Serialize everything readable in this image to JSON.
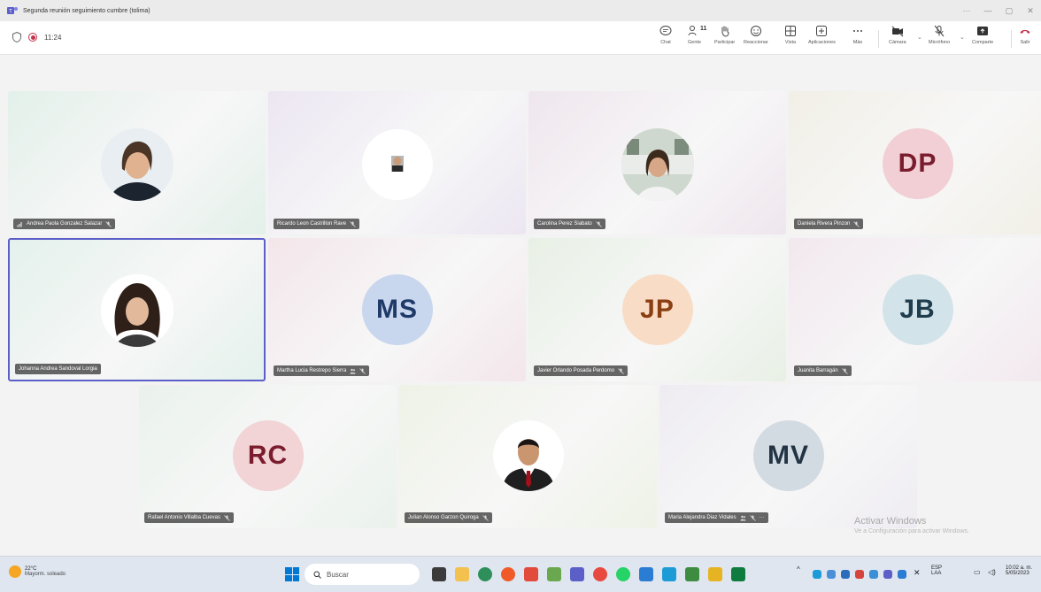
{
  "window": {
    "title": "Segunda reunión seguimiento cumbre (tolima)",
    "controls": [
      "···",
      "—",
      "▢",
      "✕"
    ]
  },
  "meeting": {
    "timer": "11:24",
    "people_count": "11",
    "tools": [
      {
        "label": "Chat",
        "icon": "chat-icon"
      },
      {
        "label": "Gente",
        "icon": "people-icon"
      },
      {
        "label": "Participar",
        "icon": "raise-hand-icon"
      },
      {
        "label": "Reaccionar",
        "icon": "react-icon"
      },
      {
        "label": "Vista",
        "icon": "view-icon"
      },
      {
        "label": "Aplicaciones",
        "icon": "apps-icon"
      },
      {
        "label": "Más",
        "icon": "more-icon"
      },
      {
        "label": "Cámara",
        "icon": "camera-icon"
      },
      {
        "label": "Micrófono",
        "icon": "mic-icon"
      },
      {
        "label": "Comparte",
        "icon": "share-icon"
      },
      {
        "label": "Salir",
        "icon": "leave-icon"
      }
    ]
  },
  "participants": [
    {
      "name": "Andrea Paola Gonzalez Salazar",
      "type": "photo",
      "bg": "#e3f0ea"
    },
    {
      "name": "Ricardo Leon Castrillon Rave",
      "type": "photo",
      "bg": "#ece6f2"
    },
    {
      "name": "Carolina Perez Siabato",
      "type": "photo",
      "bg": "#efe6ee"
    },
    {
      "name": "Daniela Rivera Pinzon",
      "initials": "DP",
      "type": "initials",
      "bg": "#f1efe6",
      "avatar_bg": "#f2cfd4",
      "avatar_fg": "#7a1c2e"
    },
    {
      "name": "Johanna Andrea Sandoval Lorgia",
      "type": "photo",
      "bg": "#e4f1ec"
    },
    {
      "name": "Martha Lucia Restrepo Sierra",
      "initials": "MS",
      "type": "initials",
      "bg": "#f3e6ea",
      "avatar_bg": "#c8d6ee",
      "avatar_fg": "#1f3a68"
    },
    {
      "name": "Javier Orlando Posada Perdomo",
      "initials": "JP",
      "type": "initials",
      "bg": "#e8f0e5",
      "avatar_bg": "#f9dcc6",
      "avatar_fg": "#8a3f12"
    },
    {
      "name": "Juanita Barragán",
      "initials": "JB",
      "type": "initials",
      "bg": "#f2e8ee",
      "avatar_bg": "#d3e3ea",
      "avatar_fg": "#1f3d4d"
    },
    {
      "name": "Rafael Antonio Villalba Cuevas",
      "initials": "RC",
      "type": "initials",
      "bg": "#eaf2ec",
      "avatar_bg": "#f2d3d6",
      "avatar_fg": "#7a1c2e"
    },
    {
      "name": "Julian Alonso Garzon Quiroga",
      "type": "photo",
      "bg": "#eef2e6"
    },
    {
      "name": "Maria Alejandra Diaz Vidales",
      "initials": "MV",
      "type": "initials",
      "bg": "#eeecf2",
      "avatar_bg": "#d3dbe2",
      "avatar_fg": "#223344"
    }
  ],
  "activation": {
    "title": "Activar Windows",
    "subtitle": "Ve a Configuración para activar Windows."
  },
  "taskbar": {
    "temp": "22°C",
    "weather": "Mayorm. soleado",
    "search_placeholder": "Buscar",
    "lang": "ESP",
    "lang2": "LAA",
    "time": "10:02 a. m.",
    "date": "5/05/2023"
  },
  "colors": {
    "accent": "#5b5fc7",
    "record": "#c4314b",
    "leave": "#c4314b"
  }
}
